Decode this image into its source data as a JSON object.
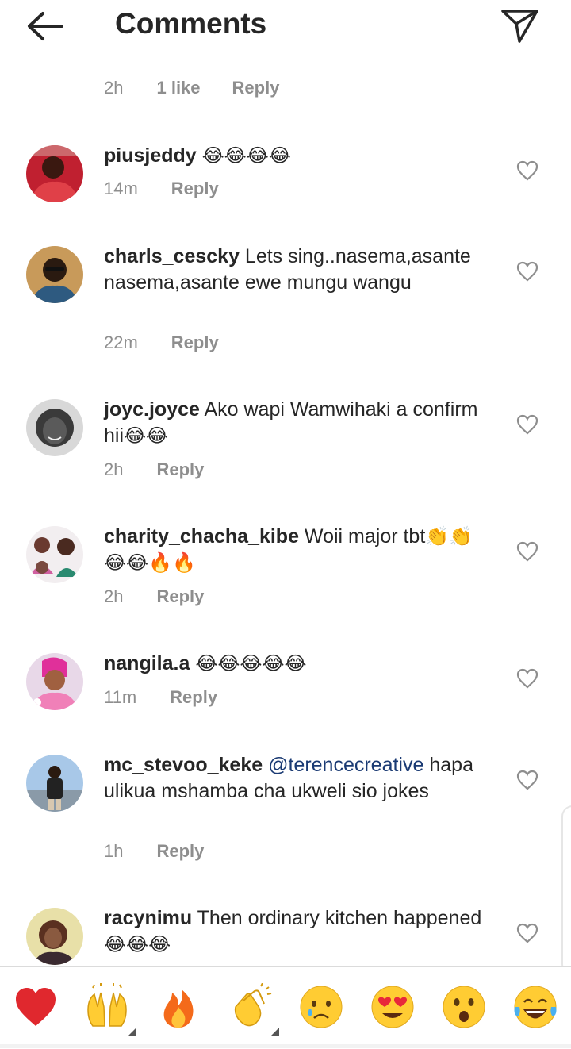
{
  "header": {
    "title": "Comments"
  },
  "top_meta": {
    "time": "2h",
    "likes": "1 like",
    "reply": "Reply"
  },
  "comments": [
    {
      "user": "piusjeddy",
      "text": "",
      "emoji": "😂😂😂😂",
      "time": "14m",
      "reply": "Reply"
    },
    {
      "user": "charls_cescky",
      "text": " Lets sing..nasema,asante nasema,asante ewe mungu wangu",
      "emoji": "",
      "time": "22m",
      "reply": "Reply"
    },
    {
      "user": "joyc.joyce",
      "text": " Ako wapi Wamwihaki a confirm hii",
      "emoji": "😂😂",
      "time": "2h",
      "reply": "Reply"
    },
    {
      "user": "charity_chacha_kibe",
      "text": " Woii major tbt",
      "emoji": "👏👏😂😂🔥🔥",
      "time": "2h",
      "reply": "Reply"
    },
    {
      "user": "nangila.a",
      "text": "",
      "emoji": "😂😂😂😂😂",
      "time": "11m",
      "reply": "Reply"
    },
    {
      "user": "mc_stevoo_keke",
      "mention": "@terencecreative",
      "text": " hapa ulikua mshamba cha ukweli sio jokes",
      "emoji": "",
      "time": "1h",
      "reply": "Reply"
    },
    {
      "user": "racynimu",
      "text": " Then ordinary kitchen happened",
      "emoji": "😂😂😂",
      "time": "",
      "reply": ""
    }
  ],
  "emoji_bar": [
    "red-heart",
    "raising-hands",
    "fire",
    "clapping-hands",
    "crying-face",
    "heart-eyes-face",
    "astonished-face",
    "tears-of-joy-face"
  ],
  "colors": {
    "text": "#262626",
    "meta": "#8e8e8e",
    "mention": "#1a3a73",
    "heart_red": "#e0282e",
    "emoji_yellow": "#ffcc33"
  }
}
